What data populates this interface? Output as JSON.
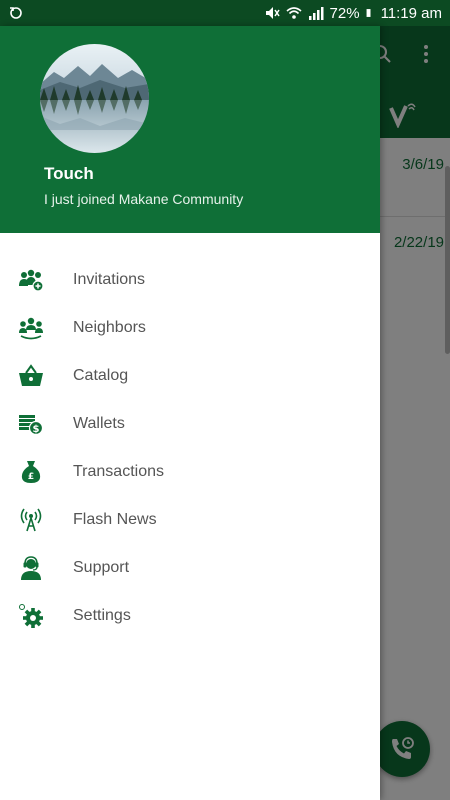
{
  "status_bar": {
    "battery_percent": "72%",
    "time": "11:19 am"
  },
  "background_app": {
    "dates": [
      "3/6/19",
      "2/22/19"
    ]
  },
  "drawer": {
    "user_name": "Touch",
    "user_status": "I just joined Makane Community",
    "items": [
      {
        "label": "Invitations",
        "icon": "invitations-icon"
      },
      {
        "label": "Neighbors",
        "icon": "neighbors-icon"
      },
      {
        "label": "Catalog",
        "icon": "basket-icon"
      },
      {
        "label": "Wallets",
        "icon": "wallet-icon"
      },
      {
        "label": "Transactions",
        "icon": "money-bag-icon"
      },
      {
        "label": "Flash News",
        "icon": "broadcast-antenna-icon"
      },
      {
        "label": "Support",
        "icon": "support-agent-icon"
      },
      {
        "label": "Settings",
        "icon": "settings-gear-icon"
      }
    ]
  },
  "colors": {
    "primary": "#0f6f37",
    "status_bar": "#0c4a22",
    "menu_text": "#555555"
  }
}
